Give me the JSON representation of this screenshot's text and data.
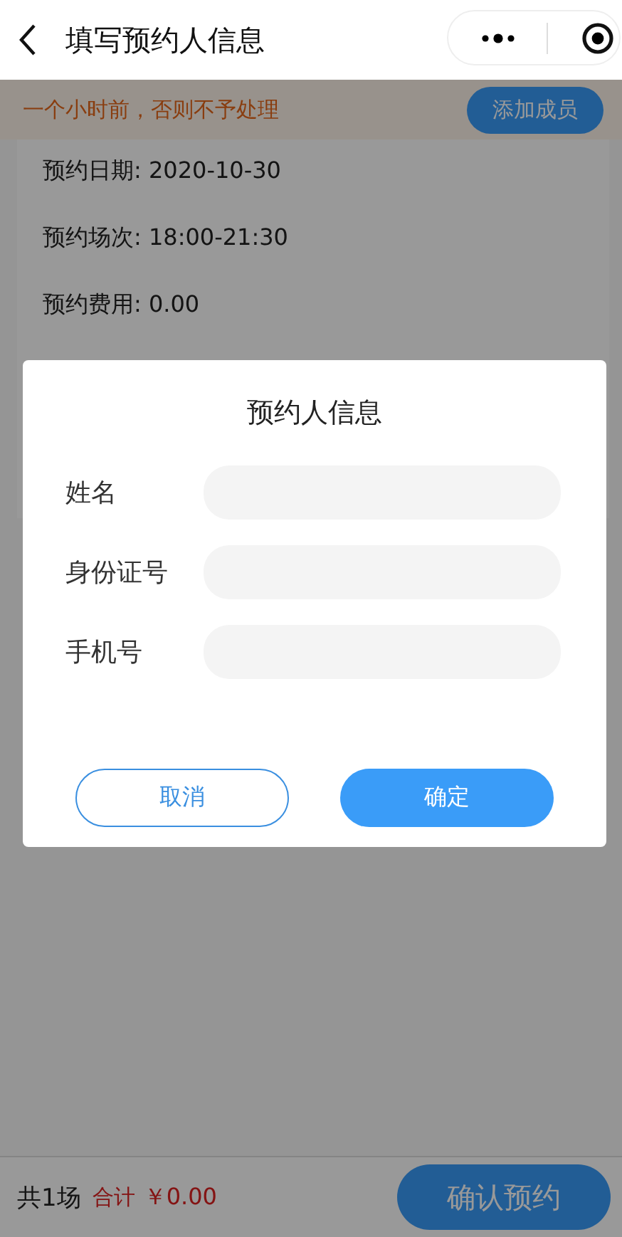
{
  "nav": {
    "title": "填写预约人信息"
  },
  "notice": {
    "text": "一个小时前，否则不予处理",
    "button": "添加成员"
  },
  "details": [
    {
      "text": "预约日期: 2020-10-30"
    },
    {
      "text": "预约场次: 18:00-21:30"
    },
    {
      "text": "预约费用: 0.00"
    }
  ],
  "dialog": {
    "title": "预约人信息",
    "fields": [
      {
        "label": "姓名"
      },
      {
        "label": "身份证号"
      },
      {
        "label": "手机号"
      }
    ],
    "buttons": [
      {
        "label": "取消",
        "kind": "secondary"
      },
      {
        "label": "确定",
        "kind": "primary"
      }
    ]
  },
  "footer": {
    "count": "共1场",
    "total_label": "合计",
    "total": "￥0.00",
    "submit": "确认预约"
  }
}
